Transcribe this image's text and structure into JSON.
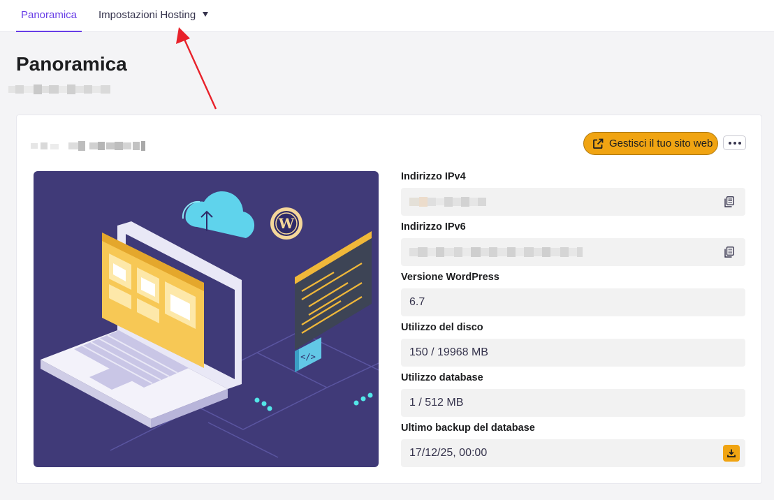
{
  "nav": {
    "tabs": [
      {
        "label": "Panoramica",
        "active": true
      },
      {
        "label": "Impostazioni Hosting",
        "active": false
      }
    ]
  },
  "page": {
    "title": "Panoramica"
  },
  "card": {
    "manage_button": "Gestisci il tuo sito web",
    "more_icon": "more-horizontal-icon",
    "fields": [
      {
        "label": "Indirizzo IPv4",
        "value": "",
        "icon": "copy-icon"
      },
      {
        "label": "Indirizzo IPv6",
        "value": "",
        "icon": "copy-icon"
      },
      {
        "label": "Versione WordPress",
        "value": "6.7"
      },
      {
        "label": "Utilizzo del disco",
        "value": "150 / 19968 MB"
      },
      {
        "label": "Utilizzo database",
        "value": "1 / 512 MB"
      },
      {
        "label": "Ultimo backup del database",
        "value": "17/12/25, 00:00",
        "icon": "download-icon"
      }
    ]
  },
  "colors": {
    "accent": "#673de6",
    "button": "#f0a412",
    "illustration_bg": "#403a78"
  }
}
